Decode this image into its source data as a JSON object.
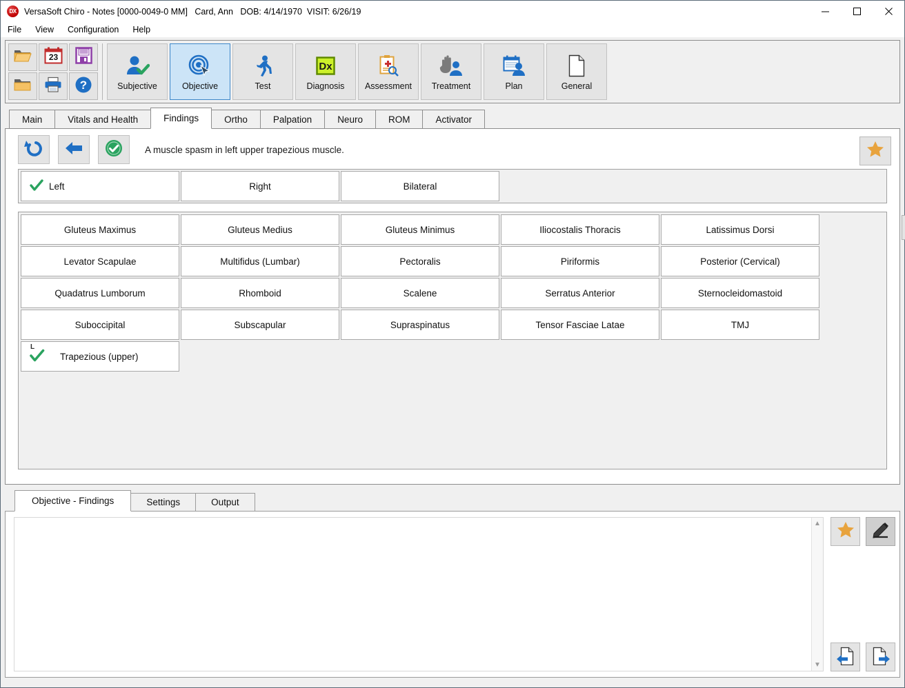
{
  "window": {
    "app_icon": "app-dx-icon",
    "title": "VersaSoft Chiro - Notes [0000-0049-0 MM]   Card, Ann   DOB: 4/14/1970  VISIT: 6/26/19",
    "minimize": "minimize-icon",
    "maximize": "maximize-icon",
    "close": "close-icon"
  },
  "menu": {
    "items": [
      {
        "label": "File"
      },
      {
        "label": "View"
      },
      {
        "label": "Configuration"
      },
      {
        "label": "Help"
      }
    ]
  },
  "toolbar": {
    "small_buttons": [
      {
        "name": "open-folder-button",
        "icon": "open-folder-icon"
      },
      {
        "name": "calendar-button",
        "icon": "calendar-23-icon"
      },
      {
        "name": "save-button",
        "icon": "floppy-disk-icon"
      },
      {
        "name": "folder-button",
        "icon": "closed-folder-icon"
      },
      {
        "name": "print-button",
        "icon": "printer-icon"
      },
      {
        "name": "help-button",
        "icon": "question-help-icon"
      }
    ],
    "section_buttons": [
      {
        "label": "Subjective",
        "icon": "person-check-icon",
        "active": false
      },
      {
        "label": "Objective",
        "icon": "target-cursor-icon",
        "active": true
      },
      {
        "label": "Test",
        "icon": "running-person-icon",
        "active": false
      },
      {
        "label": "Diagnosis",
        "icon": "dx-badge-icon",
        "active": false
      },
      {
        "label": "Assessment",
        "icon": "clipboard-search-icon",
        "active": false
      },
      {
        "label": "Treatment",
        "icon": "hand-person-icon",
        "active": false
      },
      {
        "label": "Plan",
        "icon": "calendar-person-icon",
        "active": false
      },
      {
        "label": "General",
        "icon": "blank-page-icon",
        "active": false
      }
    ]
  },
  "tabs": {
    "items": [
      {
        "label": "Main",
        "active": false
      },
      {
        "label": "Vitals and Health",
        "active": false
      },
      {
        "label": "Findings",
        "active": true
      },
      {
        "label": "Ortho",
        "active": false
      },
      {
        "label": "Palpation",
        "active": false
      },
      {
        "label": "Neuro",
        "active": false
      },
      {
        "label": "ROM",
        "active": false
      },
      {
        "label": "Activator",
        "active": false
      }
    ]
  },
  "findings": {
    "actions": [
      {
        "name": "undo-button",
        "icon": "undo-arrow-icon"
      },
      {
        "name": "back-button",
        "icon": "left-arrow-icon"
      },
      {
        "name": "accept-button",
        "icon": "green-check-circle-icon"
      }
    ],
    "statement": "A muscle spasm in left upper trapezious muscle.",
    "favorite_icon": "star-icon",
    "settings_icon": "gear-icon",
    "laterality": [
      {
        "label": "Left",
        "selected": true
      },
      {
        "label": "Right",
        "selected": false
      },
      {
        "label": "Bilateral",
        "selected": false
      }
    ],
    "muscles": [
      {
        "label": "Gluteus Maximus",
        "selected": false,
        "side": ""
      },
      {
        "label": "Gluteus Medius",
        "selected": false,
        "side": ""
      },
      {
        "label": "Gluteus Minimus",
        "selected": false,
        "side": ""
      },
      {
        "label": "Iliocostalis Thoracis",
        "selected": false,
        "side": ""
      },
      {
        "label": "Latissimus Dorsi",
        "selected": false,
        "side": ""
      },
      {
        "label": "Levator Scapulae",
        "selected": false,
        "side": ""
      },
      {
        "label": "Multifidus (Lumbar)",
        "selected": false,
        "side": ""
      },
      {
        "label": "Pectoralis",
        "selected": false,
        "side": ""
      },
      {
        "label": "Piriformis",
        "selected": false,
        "side": ""
      },
      {
        "label": "Posterior (Cervical)",
        "selected": false,
        "side": ""
      },
      {
        "label": "Quadatrus Lumborum",
        "selected": false,
        "side": ""
      },
      {
        "label": "Rhomboid",
        "selected": false,
        "side": ""
      },
      {
        "label": "Scalene",
        "selected": false,
        "side": ""
      },
      {
        "label": "Serratus Anterior",
        "selected": false,
        "side": ""
      },
      {
        "label": "Sternocleidomastoid",
        "selected": false,
        "side": ""
      },
      {
        "label": "Suboccipital",
        "selected": false,
        "side": ""
      },
      {
        "label": "Subscapular",
        "selected": false,
        "side": ""
      },
      {
        "label": "Supraspinatus",
        "selected": false,
        "side": ""
      },
      {
        "label": "Tensor Fasciae Latae",
        "selected": false,
        "side": ""
      },
      {
        "label": "TMJ",
        "selected": false,
        "side": ""
      },
      {
        "label": "Trapezious (upper)",
        "selected": true,
        "side": "L"
      }
    ]
  },
  "bottom": {
    "tabs": [
      {
        "label": "Objective - Findings",
        "active": true
      },
      {
        "label": "Settings",
        "active": false
      },
      {
        "label": "Output",
        "active": false
      }
    ],
    "editor_value": "",
    "editor_placeholder": "",
    "scroll_up": "scroll-up-arrow-icon",
    "scroll_down": "scroll-down-arrow-icon",
    "buttons": [
      {
        "name": "favorite-button",
        "icon": "star-icon",
        "pressed": false
      },
      {
        "name": "edit-pen-button",
        "icon": "pen-edit-icon",
        "pressed": true
      },
      {
        "name": "previous-page-button",
        "icon": "page-left-arrow-icon",
        "pressed": false
      },
      {
        "name": "next-page-button",
        "icon": "page-right-arrow-icon",
        "pressed": false
      }
    ]
  },
  "colors": {
    "accent_blue": "#1f6fc4",
    "active_tab_bg": "#cce4f7",
    "active_tab_border": "#3d87c9",
    "check_green": "#2aa35f",
    "star_orange": "#e8a33d",
    "panel_bg": "#f0f0f0"
  }
}
